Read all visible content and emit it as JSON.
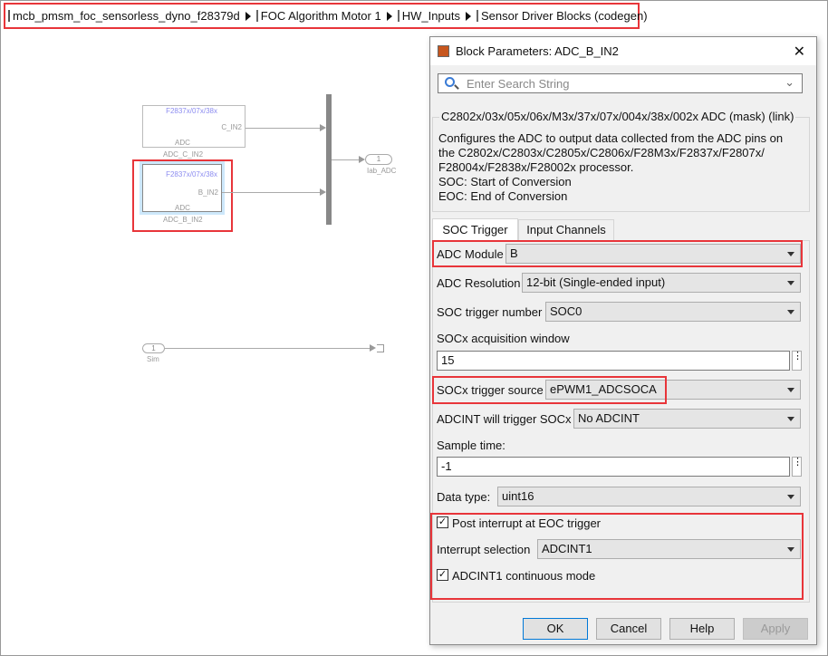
{
  "breadcrumb": [
    "mcb_pmsm_foc_sensorless_dyno_f28379d",
    "FOC Algorithm Motor 1",
    "HW_Inputs",
    "Sensor Driver Blocks (codegen)"
  ],
  "canvas": {
    "block_c": {
      "device": "F2837x/07x/38x",
      "port": "C_IN2",
      "type": "ADC",
      "name": "ADC_C_IN2"
    },
    "block_b": {
      "device": "F2837x/07x/38x",
      "port": "B_IN2",
      "type": "ADC",
      "name": "ADC_B_IN2"
    },
    "outport": {
      "number": "1",
      "name": "Iab_ADC"
    },
    "inport": {
      "number": "1",
      "name": "Sim"
    }
  },
  "dialog": {
    "title": "Block Parameters: ADC_B_IN2",
    "close": "✕",
    "search_placeholder": "Enter Search String",
    "group_title": "C2802x/03x/05x/06x/M3x/37x/07x/004x/38x/002x ADC (mask) (link)",
    "description": [
      "Configures the ADC to output data collected from the ADC pins on",
      "the C2802x/C2803x/C2805x/C2806x/F28M3x/F2837x/F2807x/",
      "F28004x/F2838x/F28002x processor.",
      "SOC: Start of Conversion",
      "EOC: End of Conversion"
    ],
    "tabs": [
      "SOC Trigger",
      "Input Channels"
    ],
    "active_tab": "SOC Trigger",
    "params": {
      "adc_module": {
        "label": "ADC Module",
        "value": "B"
      },
      "adc_resolution": {
        "label": "ADC Resolution",
        "value": "12-bit (Single-ended input)"
      },
      "soc_trigger_number": {
        "label": "SOC trigger number",
        "value": "SOC0"
      },
      "acq_window": {
        "label": "SOCx acquisition window",
        "value": "15"
      },
      "trigger_source": {
        "label": "SOCx trigger source",
        "value": "ePWM1_ADCSOCA"
      },
      "adcint_trigger": {
        "label": "ADCINT will trigger SOCx",
        "value": "No ADCINT"
      },
      "sample_time": {
        "label": "Sample time:",
        "value": "-1"
      },
      "data_type": {
        "label": "Data type:",
        "value": "uint16"
      },
      "post_interrupt": {
        "label": "Post interrupt at EOC trigger",
        "checked": true
      },
      "interrupt_selection": {
        "label": "Interrupt selection",
        "value": "ADCINT1"
      },
      "continuous_mode": {
        "label": "ADCINT1 continuous mode",
        "checked": true
      }
    },
    "buttons": {
      "ok": "OK",
      "cancel": "Cancel",
      "help": "Help",
      "apply": "Apply"
    },
    "dots": "⋮",
    "check": "✓"
  },
  "colors": {
    "highlight": "#e8353a",
    "selection": "#cde8fb",
    "canvas_block_text": "#8c8cf0"
  }
}
